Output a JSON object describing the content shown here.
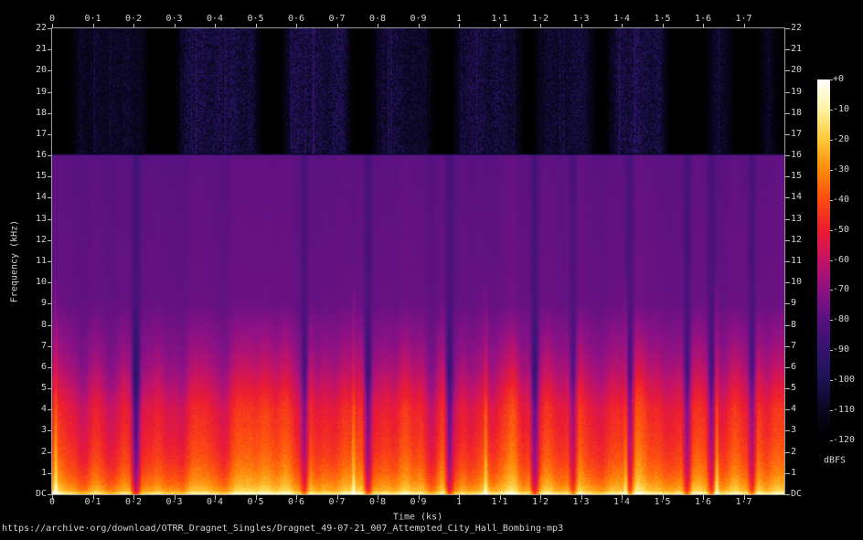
{
  "page": {
    "background": "#000000",
    "text_color": "#d4d4d4"
  },
  "chart_data": {
    "type": "heatmap",
    "subtype": "audio-spectrogram",
    "title": "https://archive·org/download/OTRR_Dragnet_Singles/Dragnet_49-07-21_007_Attempted_City_Hall_Bombing·mp3",
    "xlabel": "Time (ks)",
    "ylabel": "Frequency (kHz)",
    "x_axis": {
      "min": 0,
      "max": 1.8,
      "tick_values": [
        0,
        0.1,
        0.2,
        0.3,
        0.4,
        0.5,
        0.6,
        0.7,
        0.8,
        0.9,
        1,
        1.1,
        1.2,
        1.3,
        1.4,
        1.5,
        1.6,
        1.7
      ],
      "tick_labels": [
        "0",
        "0·1",
        "0·2",
        "0·3",
        "0·4",
        "0·5",
        "0·6",
        "0·7",
        "0·8",
        "0·9",
        "1",
        "1·1",
        "1·2",
        "1·3",
        "1·4",
        "1·5",
        "1·6",
        "1·7"
      ],
      "shown_on": [
        "top",
        "bottom"
      ]
    },
    "y_axis": {
      "min": 0,
      "max": 22,
      "tick_values": [
        22,
        21,
        20,
        19,
        18,
        17,
        16,
        15,
        14,
        13,
        12,
        11,
        10,
        9,
        8,
        7,
        6,
        5,
        4,
        3,
        2,
        1,
        0
      ],
      "tick_labels": [
        "22",
        "21",
        "20",
        "19",
        "18",
        "17",
        "16",
        "15",
        "14",
        "13",
        "12",
        "11",
        "10",
        "9",
        "8",
        "7",
        "6",
        "5",
        "4",
        "3",
        "2",
        "1",
        "DC"
      ],
      "shown_on": [
        "left",
        "right"
      ]
    },
    "colorbar": {
      "label": "dBFS",
      "max_db": 0,
      "min_db": -120,
      "tick_values": [
        0,
        -10,
        -20,
        -30,
        -40,
        -50,
        -60,
        -70,
        -80,
        -90,
        -100,
        -110,
        -120
      ],
      "tick_labels": [
        "+0",
        "-10",
        "-20",
        "-30",
        "-40",
        "-50",
        "-60",
        "-70",
        "-80",
        "-90",
        "-100",
        "-110",
        "-120"
      ],
      "palette": [
        {
          "pos": 0.0,
          "color": "#000000"
        },
        {
          "pos": 0.083,
          "color": "#0a0620"
        },
        {
          "pos": 0.167,
          "color": "#1d1253"
        },
        {
          "pos": 0.25,
          "color": "#33156f"
        },
        {
          "pos": 0.333,
          "color": "#581181"
        },
        {
          "pos": 0.417,
          "color": "#8d1186"
        },
        {
          "pos": 0.5,
          "color": "#c51367"
        },
        {
          "pos": 0.583,
          "color": "#ed1c31"
        },
        {
          "pos": 0.667,
          "color": "#fd4c10"
        },
        {
          "pos": 0.75,
          "color": "#fe8b0a"
        },
        {
          "pos": 0.833,
          "color": "#fec836"
        },
        {
          "pos": 0.917,
          "color": "#fdf3a2"
        },
        {
          "pos": 1.0,
          "color": "#ffffff"
        }
      ]
    },
    "content": {
      "description": "Spectrogram of a ~1.8 ks (30 min) mono MP3 radio recording. Speech energy fills 0-5 kHz (bright yellow-orange near DC fading through red and magenta), a flat purple MP3 noise floor spans ~9-16 kHz, a hard low-pass cutoff sits at 16 kHz, and only sparse dark-blue noise bursts appear from 16-22 kHz.",
      "mp3_cutoff_khz": 16,
      "noise_floor_db": -79,
      "freq_profile_db": [
        [
          0,
          -20
        ],
        [
          0.2,
          -24
        ],
        [
          0.5,
          -30
        ],
        [
          1,
          -36
        ],
        [
          1.5,
          -40
        ],
        [
          2,
          -43
        ],
        [
          3,
          -47
        ],
        [
          4,
          -50
        ],
        [
          5,
          -57
        ],
        [
          6,
          -64
        ],
        [
          7,
          -69
        ],
        [
          8,
          -73
        ],
        [
          9,
          -77
        ],
        [
          16,
          -79
        ],
        [
          16.1,
          -120
        ],
        [
          22,
          -120
        ]
      ],
      "quiet_gaps_ks": [
        0.205,
        0.62,
        0.775,
        0.975,
        1.185,
        1.28,
        1.42,
        1.56,
        1.62,
        1.72
      ],
      "loud_events_ks": [
        0.008,
        0.74,
        1.065,
        1.41,
        1.632
      ],
      "hf_noise_clusters_ks": [
        [
          0.04,
          0.24,
          0.5
        ],
        [
          0.3,
          0.52,
          0.75
        ],
        [
          0.56,
          0.74,
          0.85
        ],
        [
          0.78,
          0.94,
          0.6
        ],
        [
          0.98,
          1.16,
          0.7
        ],
        [
          1.18,
          1.34,
          0.6
        ],
        [
          1.36,
          1.52,
          0.8
        ],
        [
          1.6,
          1.68,
          0.5
        ],
        [
          1.73,
          1.79,
          0.45
        ]
      ]
    }
  }
}
